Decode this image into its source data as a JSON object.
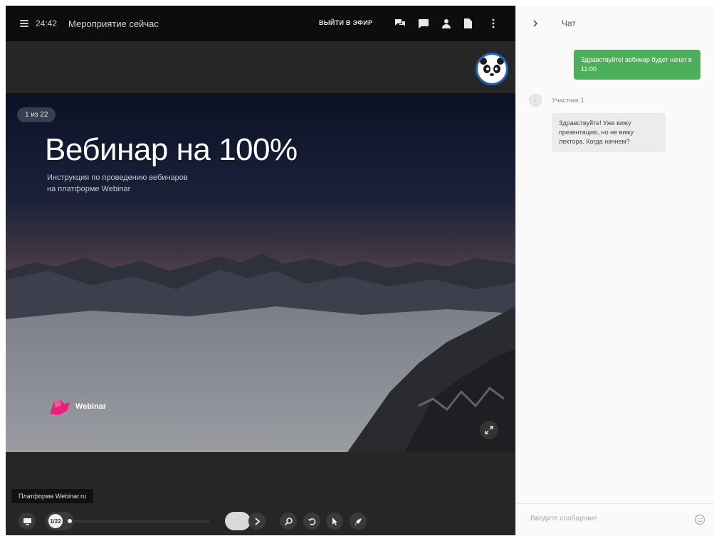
{
  "topbar": {
    "time": "24:42",
    "event_title": "Мероприятие сейчас",
    "exit_label": "ВЫЙТИ В ЭФИР",
    "icons": [
      "chat-icon",
      "message-icon",
      "user-icon",
      "document-icon",
      "more-vertical-icon"
    ]
  },
  "slide": {
    "page_badge": "1 из 22",
    "title": "Вебинар на 100%",
    "subtitle_line1": "Инструкция по проведению вебинаров",
    "subtitle_line2": "на платформе Webinar",
    "logo_text": "Webinar"
  },
  "tooltip": "Платформа Webinar.ru",
  "controls": {
    "scrubber_label": "1/22",
    "icons": [
      "screen-icon",
      "next-icon",
      "search-icon",
      "undo-icon",
      "pointer-icon",
      "rocket-icon"
    ]
  },
  "chat": {
    "title": "Чат",
    "outgoing_message": "Здравствуйте! вебинар будет начат в 11:00",
    "sender_name": "Участник 1",
    "incoming_message": "Здравствуйте! Уже вижу презентацию, но не вижу лектора. Когда начнем?",
    "input_placeholder": "Введите сообщение"
  },
  "colors": {
    "topbar_bg": "#0d0d0d",
    "stage_bg": "#262626",
    "outgoing_bubble": "#4caf5a",
    "incoming_bubble": "#ececec",
    "logo_accent": "#e6237d",
    "avatar_border": "#1f63b8"
  }
}
